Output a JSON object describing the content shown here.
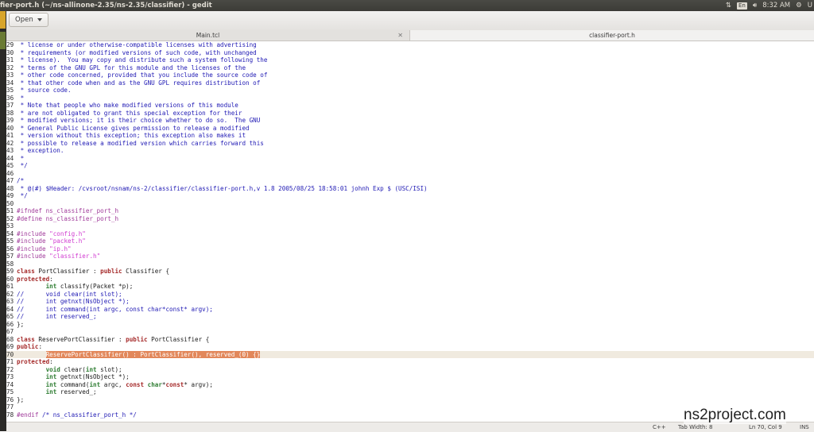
{
  "window": {
    "title": "fier-port.h (~/ns-allinone-2.35/ns-2.35/classifier) - gedit"
  },
  "tray": {
    "keyboard": "En",
    "time": "8:32 AM",
    "user": "U"
  },
  "toolbar": {
    "open_label": "Open"
  },
  "tabs": [
    {
      "label": "Main.tcl",
      "close": "✕"
    },
    {
      "label": "classifier-port.h"
    }
  ],
  "editor": {
    "current_line": 70,
    "lines": [
      {
        "n": "29",
        "segs": [
          [
            "c",
            " * license or under otherwise-compatible licenses with advertising"
          ]
        ]
      },
      {
        "n": "30",
        "segs": [
          [
            "c",
            " * requirements (or modified versions of such code, with unchanged"
          ]
        ]
      },
      {
        "n": "31",
        "segs": [
          [
            "c",
            " * license).  You may copy and distribute such a system following the"
          ]
        ]
      },
      {
        "n": "32",
        "segs": [
          [
            "c",
            " * terms of the GNU GPL for this module and the licenses of the"
          ]
        ]
      },
      {
        "n": "33",
        "segs": [
          [
            "c",
            " * other code concerned, provided that you include the source code of"
          ]
        ]
      },
      {
        "n": "34",
        "segs": [
          [
            "c",
            " * that other code when and as the GNU GPL requires distribution of"
          ]
        ]
      },
      {
        "n": "35",
        "segs": [
          [
            "c",
            " * source code."
          ]
        ]
      },
      {
        "n": "36",
        "segs": [
          [
            "c",
            " *"
          ]
        ]
      },
      {
        "n": "37",
        "segs": [
          [
            "c",
            " * Note that people who make modified versions of this module"
          ]
        ]
      },
      {
        "n": "38",
        "segs": [
          [
            "c",
            " * are not obligated to grant this special exception for their"
          ]
        ]
      },
      {
        "n": "39",
        "segs": [
          [
            "c",
            " * modified versions; it is their choice whether to do so.  The GNU"
          ]
        ]
      },
      {
        "n": "40",
        "segs": [
          [
            "c",
            " * General Public License gives permission to release a modified"
          ]
        ]
      },
      {
        "n": "41",
        "segs": [
          [
            "c",
            " * version without this exception; this exception also makes it"
          ]
        ]
      },
      {
        "n": "42",
        "segs": [
          [
            "c",
            " * possible to release a modified version which carries forward this"
          ]
        ]
      },
      {
        "n": "43",
        "segs": [
          [
            "c",
            " * exception."
          ]
        ]
      },
      {
        "n": "44",
        "segs": [
          [
            "c",
            " *"
          ]
        ]
      },
      {
        "n": "45",
        "segs": [
          [
            "c",
            " */"
          ]
        ]
      },
      {
        "n": "46",
        "segs": []
      },
      {
        "n": "47",
        "segs": [
          [
            "c",
            "/*"
          ]
        ]
      },
      {
        "n": "48",
        "segs": [
          [
            "c",
            " * @(#) $Header: /cvsroot/nsnam/ns-2/classifier/classifier-port.h,v 1.8 2005/08/25 18:58:01 johnh Exp $ (USC/ISI)"
          ]
        ]
      },
      {
        "n": "49",
        "segs": [
          [
            "c",
            " */"
          ]
        ]
      },
      {
        "n": "50",
        "segs": []
      },
      {
        "n": "51",
        "segs": [
          [
            "pp",
            "#ifndef ns_classifier_port_h"
          ]
        ]
      },
      {
        "n": "52",
        "segs": [
          [
            "pp",
            "#define ns_classifier_port_h"
          ]
        ]
      },
      {
        "n": "53",
        "segs": []
      },
      {
        "n": "54",
        "segs": [
          [
            "pp",
            "#include "
          ],
          [
            "str",
            "\"config.h\""
          ]
        ]
      },
      {
        "n": "55",
        "segs": [
          [
            "pp",
            "#include "
          ],
          [
            "str",
            "\"packet.h\""
          ]
        ]
      },
      {
        "n": "56",
        "segs": [
          [
            "pp",
            "#include "
          ],
          [
            "str",
            "\"ip.h\""
          ]
        ]
      },
      {
        "n": "57",
        "segs": [
          [
            "pp",
            "#include "
          ],
          [
            "str",
            "\"classifier.h\""
          ]
        ]
      },
      {
        "n": "58",
        "segs": []
      },
      {
        "n": "59",
        "segs": [
          [
            "kw",
            "class"
          ],
          [
            "",
            " PortClassifier : "
          ],
          [
            "kw",
            "public"
          ],
          [
            "",
            " Classifier {"
          ]
        ]
      },
      {
        "n": "60",
        "segs": [
          [
            "kw",
            "protected"
          ],
          [
            "",
            ":"
          ]
        ]
      },
      {
        "n": "61",
        "segs": [
          [
            "",
            "        "
          ],
          [
            "ty",
            "int"
          ],
          [
            "",
            " classify(Packet *p);"
          ]
        ]
      },
      {
        "n": "62",
        "segs": [
          [
            "c",
            "//      void clear(int slot);"
          ]
        ]
      },
      {
        "n": "63",
        "segs": [
          [
            "c",
            "//      int getnxt(NsObject *);"
          ]
        ]
      },
      {
        "n": "64",
        "segs": [
          [
            "c",
            "//      int command(int argc, const char*const* argv);"
          ]
        ]
      },
      {
        "n": "65",
        "segs": [
          [
            "c",
            "//      int reserved_;"
          ]
        ]
      },
      {
        "n": "66",
        "segs": [
          [
            "",
            "};"
          ]
        ]
      },
      {
        "n": "67",
        "segs": []
      },
      {
        "n": "68",
        "segs": [
          [
            "kw",
            "class"
          ],
          [
            "",
            " ReservePortClassifier : "
          ],
          [
            "kw",
            "public"
          ],
          [
            "",
            " PortClassifier {"
          ]
        ]
      },
      {
        "n": "69",
        "segs": [
          [
            "kw",
            "public"
          ],
          [
            "",
            ":"
          ]
        ]
      },
      {
        "n": "70",
        "segs": [
          [
            "",
            "        "
          ],
          [
            "sel",
            "ReservePortClassifier() : PortClassifier(), reserved_(0) {}"
          ]
        ]
      },
      {
        "n": "71",
        "segs": [
          [
            "kw",
            "protected"
          ],
          [
            "",
            ":"
          ]
        ]
      },
      {
        "n": "72",
        "segs": [
          [
            "",
            "        "
          ],
          [
            "ty",
            "void"
          ],
          [
            "",
            " clear("
          ],
          [
            "ty",
            "int"
          ],
          [
            "",
            " slot);"
          ]
        ]
      },
      {
        "n": "73",
        "segs": [
          [
            "",
            "        "
          ],
          [
            "ty",
            "int"
          ],
          [
            "",
            " getnxt(NsObject *);"
          ]
        ]
      },
      {
        "n": "74",
        "segs": [
          [
            "",
            "        "
          ],
          [
            "ty",
            "int"
          ],
          [
            "",
            " command("
          ],
          [
            "ty",
            "int"
          ],
          [
            "",
            " argc, "
          ],
          [
            "kw",
            "const"
          ],
          [
            "",
            " "
          ],
          [
            "ty",
            "char"
          ],
          [
            "",
            "*"
          ],
          [
            "kw",
            "const"
          ],
          [
            "",
            "* argv);"
          ]
        ]
      },
      {
        "n": "75",
        "segs": [
          [
            "",
            "        "
          ],
          [
            "ty",
            "int"
          ],
          [
            "",
            " reserved_;"
          ]
        ]
      },
      {
        "n": "76",
        "segs": [
          [
            "",
            "};"
          ]
        ]
      },
      {
        "n": "77",
        "segs": []
      },
      {
        "n": "78",
        "segs": [
          [
            "pp",
            "#endif"
          ],
          [
            "",
            " "
          ],
          [
            "c",
            "/* ns_classifier_port_h */"
          ]
        ]
      }
    ]
  },
  "statusbar": {
    "language": "C++",
    "tab_width": "Tab Width: 8",
    "position": "Ln 70, Col 9",
    "mode": "INS"
  },
  "watermark": "ns2project.com",
  "colors": {
    "comment": "#1f19b4",
    "preprocessor": "#a03a9a",
    "keyword": "#a52a2a",
    "type": "#2e7d32",
    "string": "#d13bd1",
    "selection": "#e2875a"
  }
}
